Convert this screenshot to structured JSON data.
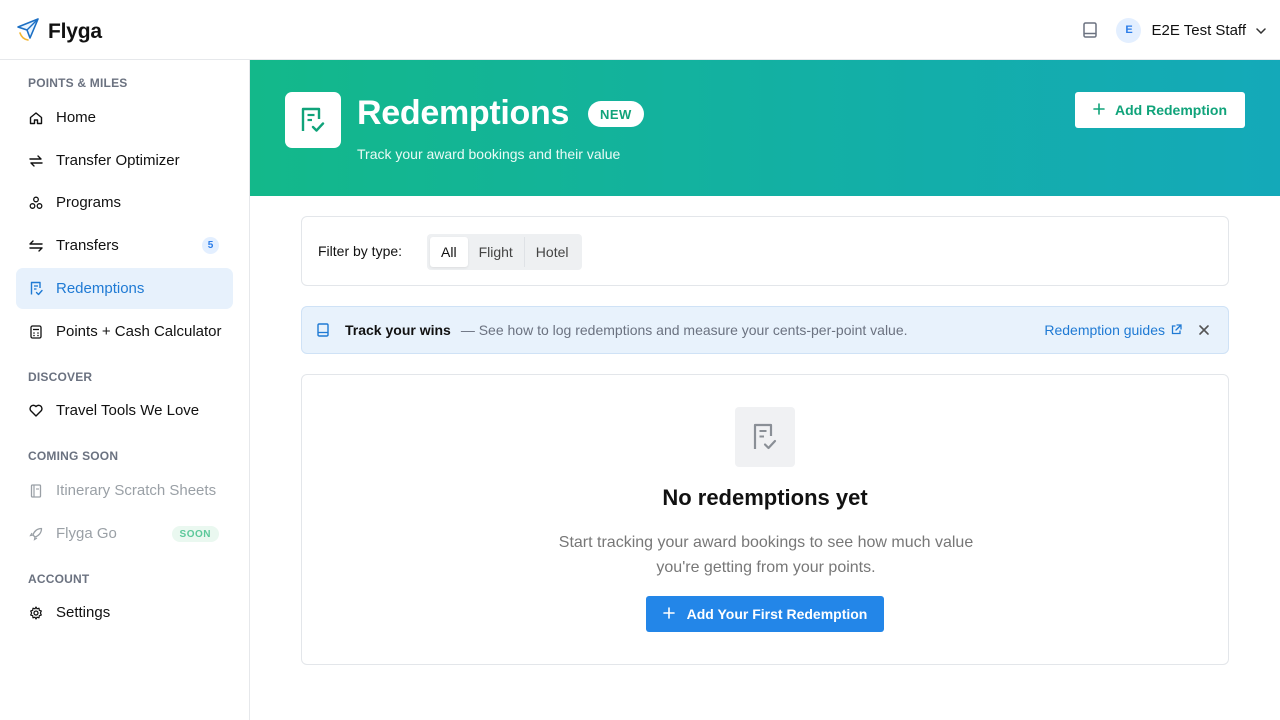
{
  "app": {
    "name": "Flyga"
  },
  "user": {
    "initial": "E",
    "name": "E2E Test Staff"
  },
  "sidebar": {
    "sections": [
      {
        "label": "POINTS & MILES"
      },
      {
        "label": "DISCOVER"
      },
      {
        "label": "COMING SOON"
      },
      {
        "label": "ACCOUNT"
      }
    ],
    "items": [
      {
        "label": "Home",
        "icon": "home-icon"
      },
      {
        "label": "Transfer Optimizer",
        "icon": "arrows-icon"
      },
      {
        "label": "Programs",
        "icon": "programs-icon"
      },
      {
        "label": "Transfers",
        "icon": "transfer-icon",
        "badge": "5"
      },
      {
        "label": "Redemptions",
        "icon": "receipt-check-icon",
        "active": true
      },
      {
        "label": "Points + Cash Calculator",
        "icon": "calculator-icon"
      },
      {
        "label": "Travel Tools We Love",
        "icon": "heart-icon"
      },
      {
        "label": "Itinerary Scratch Sheets",
        "icon": "notebook-icon",
        "disabled": true
      },
      {
        "label": "Flyga Go",
        "icon": "rocket-icon",
        "disabled": true,
        "badge": "SOON"
      },
      {
        "label": "Settings",
        "icon": "gear-icon"
      }
    ]
  },
  "header": {
    "title": "Redemptions",
    "badge": "NEW",
    "subtitle": "Track your award bookings and their value",
    "add_button": "Add Redemption"
  },
  "filter": {
    "label": "Filter by type:",
    "options": [
      "All",
      "Flight",
      "Hotel"
    ],
    "selected": "All"
  },
  "banner": {
    "title": "Track your wins",
    "text": "— See how to log redemptions and measure your cents-per-point value.",
    "link": "Redemption guides"
  },
  "empty_state": {
    "title": "No redemptions yet",
    "text": "Start tracking your award bookings to see how much value you're getting from your points.",
    "button": "Add Your First Redemption"
  },
  "colors": {
    "accent": "#2386e8",
    "hero_start": "#13b88a",
    "hero_end": "#14a9b9",
    "active_nav_bg": "#e7f1fc",
    "link": "#1f7ad4"
  }
}
